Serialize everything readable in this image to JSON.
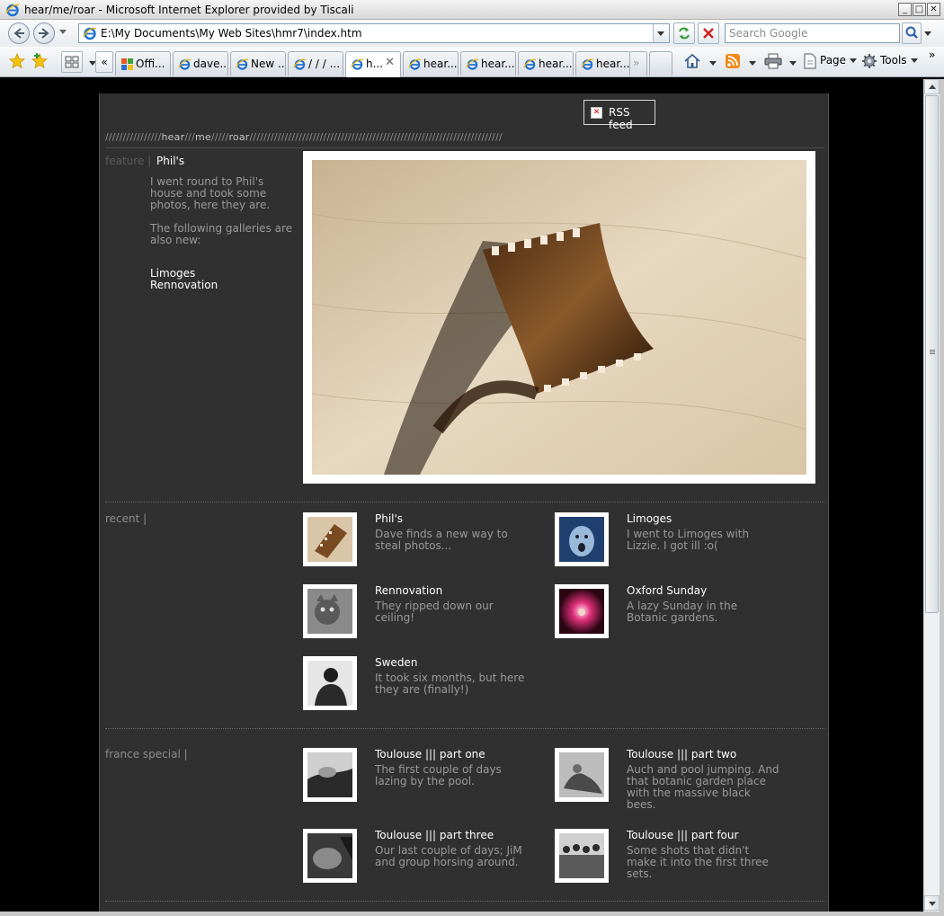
{
  "window": {
    "title": "hear/me/roar - Microsoft Internet Explorer provided by Tiscali",
    "minimize": "_",
    "maximize": "□",
    "close": "✕"
  },
  "navbar": {
    "address": "E:\\My Documents\\My Web Sites\\hmr7\\index.htm",
    "search_placeholder": "Search Google"
  },
  "tabs": [
    {
      "label": "Offi..."
    },
    {
      "label": "dave..."
    },
    {
      "label": "New ..."
    },
    {
      "label": "/ / / ..."
    },
    {
      "label": "h...",
      "active": true
    },
    {
      "label": "hear..."
    },
    {
      "label": "hear..."
    },
    {
      "label": "hear..."
    },
    {
      "label": "hear..."
    }
  ],
  "toolbar": {
    "page_label": "Page",
    "tools_label": "Tools",
    "tab_list_label": "«",
    "more_tabs_label": "»",
    "chevron_label": "»"
  },
  "site": {
    "head_pre": "////////////////",
    "head_hear": "hear",
    "head_sep1": "///",
    "head_me": "me",
    "head_sep2": "/////",
    "head_roar": "roar",
    "head_post": "////////////////////////////////////////////////////////////////////////",
    "rss_label": "RSS feed",
    "rss_icon": "✕"
  },
  "feature": {
    "label": "feature |",
    "title": "Phil's",
    "text1": "I went round to Phil's house and took some photos, here they are.",
    "text2": "The following galleries are also new:",
    "links": [
      "Limoges",
      "Rennovation"
    ]
  },
  "recent": {
    "label": "recent |",
    "items": [
      {
        "title": "Phil's",
        "desc": "Dave finds a new way to steal photos..."
      },
      {
        "title": "Limoges",
        "desc": "I went to Limoges with Lizzie. I got ill :o("
      },
      {
        "title": "Rennovation",
        "desc": "They ripped down our ceiling!"
      },
      {
        "title": "Oxford Sunday",
        "desc": "A lazy Sunday in the Botanic gardens."
      },
      {
        "title": "Sweden",
        "desc": "It took six months, but here they are (finally!)"
      }
    ]
  },
  "france": {
    "label": "france special |",
    "items": [
      {
        "title": "Toulouse ||| part one",
        "desc": "The first couple of days lazing by the pool."
      },
      {
        "title": "Toulouse ||| part two",
        "desc": "Auch and pool jumping. And that botanic garden place with the massive black bees."
      },
      {
        "title": "Toulouse ||| part three",
        "desc": "Our last couple of days; JiM and group horsing around."
      },
      {
        "title": "Toulouse ||| part four",
        "desc": "Some shots that didn't make it into the first three sets."
      }
    ]
  },
  "colors": {
    "page_bg": "#303030",
    "outer_bg": "#000000",
    "text_muted": "#9a9a9a",
    "text_bright": "#ffffff"
  }
}
